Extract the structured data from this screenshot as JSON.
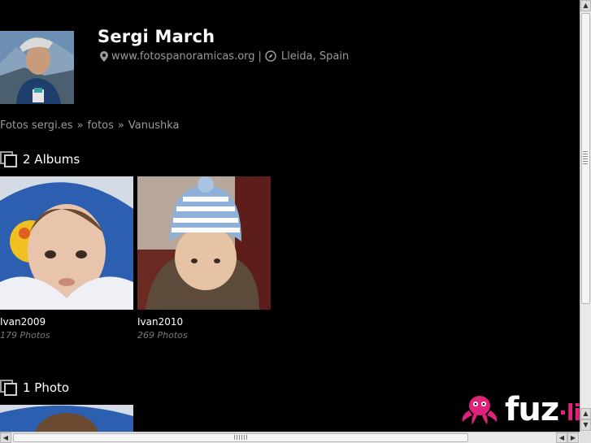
{
  "profile": {
    "name": "Sergi March",
    "website": "www.fotospanoramicas.org",
    "separator": "|",
    "location": "Lleida, Spain"
  },
  "breadcrumb": {
    "items": [
      "Fotos sergi.es",
      "fotos",
      "Vanushka"
    ],
    "arrow": "»"
  },
  "albums_section": {
    "title": "2 Albums"
  },
  "albums": [
    {
      "title": "Ivan2009",
      "count": "179 Photos"
    },
    {
      "title": "Ivan2010",
      "count": "269 Photos"
    }
  ],
  "photos_section": {
    "title": "1 Photo"
  },
  "logo": {
    "brand": "fuz",
    "dot": "·",
    "suffix": "li"
  },
  "colors": {
    "background": "#000000",
    "muted": "#9a9a9a",
    "brand_pink": "#e0237a"
  },
  "icons": [
    "map-marker-icon",
    "compass-icon",
    "album-stack-icon"
  ]
}
